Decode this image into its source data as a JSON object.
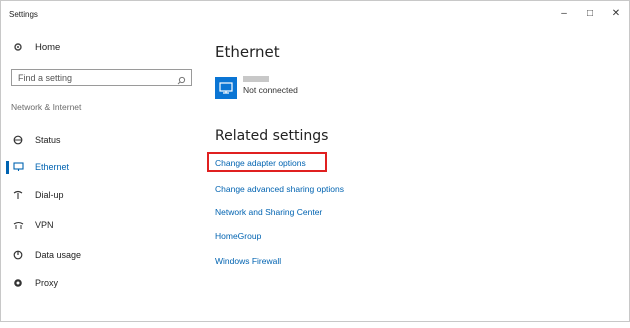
{
  "window": {
    "title": "Settings",
    "controls": {
      "minimize": "–",
      "maximize": "□",
      "close": "✕"
    }
  },
  "sidebar": {
    "home_label": "Home",
    "search_placeholder": "Find a setting",
    "section_label": "Network & Internet",
    "items": [
      {
        "label": "Status",
        "icon": "globe-icon"
      },
      {
        "label": "Ethernet",
        "icon": "ethernet-icon",
        "selected": true
      },
      {
        "label": "Dial-up",
        "icon": "dialup-icon"
      },
      {
        "label": "VPN",
        "icon": "vpn-icon"
      },
      {
        "label": "Data usage",
        "icon": "data-usage-icon"
      },
      {
        "label": "Proxy",
        "icon": "proxy-icon"
      }
    ]
  },
  "main": {
    "title": "Ethernet",
    "connection_status": "Not connected",
    "related_heading": "Related settings",
    "links": [
      "Change adapter options",
      "Change advanced sharing options",
      "Network and Sharing Center",
      "HomeGroup",
      "Windows Firewall"
    ]
  },
  "colors": {
    "accent": "#0063b1",
    "tile": "#0a75d4",
    "highlight": "#e02020"
  }
}
